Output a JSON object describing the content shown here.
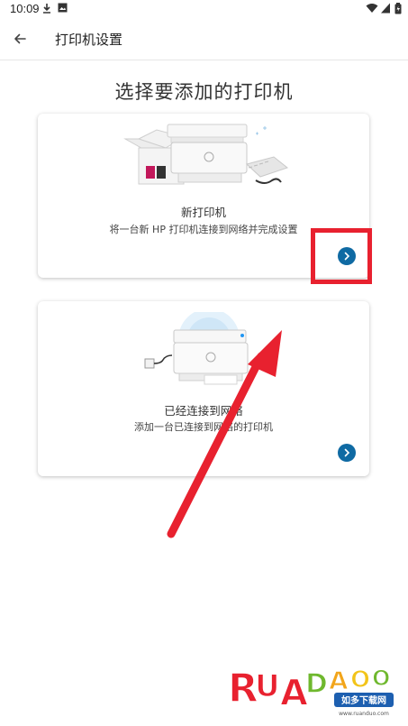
{
  "status_bar": {
    "time": "10:09"
  },
  "app_bar": {
    "title": "打印机设置"
  },
  "heading": "选择要添加的打印机",
  "cards": [
    {
      "title": "新打印机",
      "description": "将一台新 HP 打印机连接到网络并完成设置"
    },
    {
      "title": "已经连接到网络",
      "description": "添加一台已连接到网络的打印机"
    }
  ],
  "watermark": {
    "brand": "RUANDAO",
    "tagline": "如多下载网",
    "url": "www.ruanduo.com"
  },
  "colors": {
    "accent": "#0f6aa3",
    "annotation": "#e8212f"
  }
}
